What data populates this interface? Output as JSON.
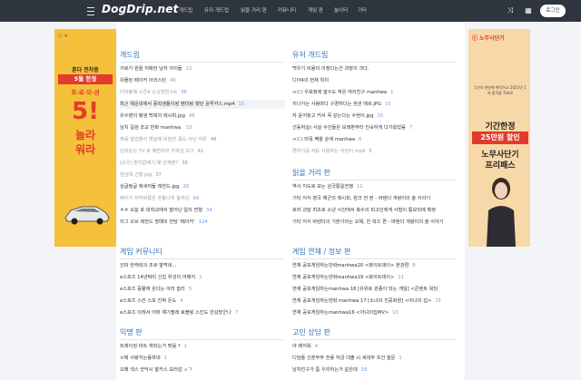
{
  "header": {
    "logo": "DogDrip.net",
    "nav": [
      "개드립",
      "유저 개드립",
      "읽을 거리 판",
      "커뮤니티",
      "게임 판",
      "놀이터",
      "기타"
    ],
    "login_label": "로그인"
  },
  "ads": {
    "left": {
      "badge": "ⓘ ×",
      "line1": "혼다 전차종",
      "line2": "5월 한정",
      "line3": "프·로·모·션",
      "line4": "5!",
      "line5": "놀라",
      "line6": "워라"
    },
    "right": {
      "badge": "ⓒ 노무사단기",
      "small": "1년차 한번에 취득하고 2025년 1차 합격을 목표로",
      "line1": "기간한정",
      "line2": "25만원 할인",
      "line3": "노무사단기",
      "line4": "프리패스"
    }
  },
  "sections": {
    "gaedrip": {
      "title": "개드립",
      "items": [
        {
          "t": "가로가 원을 지배한 남자 아이들",
          "c": "22"
        },
        {
          "t": "유물된 페이커 아리스틴",
          "c": "40"
        },
        {
          "t": "디마불패 시즌4 소상방연.txt",
          "c": "36"
        },
        {
          "t": "최근 해운대에서 중학생들이랑 팬미팅 했던 윤루카스.mp4",
          "c": "15"
        },
        {
          "t": "유수영의 평생 백복이 레시피.jpg",
          "c": "48"
        },
        {
          "t": "남치 길검 조교 만화 manhwa.",
          "c": "33"
        },
        {
          "t": "파를 벌었을어 맨날에 비밀한 콩도 아닌 여유",
          "c": "48"
        },
        {
          "t": "인라운은 TV 로 해변처리 카르님 보기",
          "c": "41"
        },
        {
          "t": "[오우] 펀치없애기 왜 단체엔?",
          "c": "38"
        },
        {
          "t": "현남대 근황.jpg",
          "c": "37"
        },
        {
          "t": "싱글벙글 애새끼들 레전드.jpg",
          "c": "28"
        },
        {
          "t": "배우가 저작바롱은 흔들나게 들려감",
          "c": "94"
        },
        {
          "t": "ㅎㅎ 오늘 포 대학교에서 발어난 일의 전형",
          "c": "34"
        },
        {
          "t": "리그 오브 레전드 명예의 전당 '페이커'",
          "c": "124"
        }
      ]
    },
    "user": {
      "title": "유저 개드립",
      "items": [
        {
          "t": "백우기 비용이 이정다는건 과장이 크다.",
          "c": ""
        },
        {
          "t": "디아4의 현재 위치",
          "c": ""
        },
        {
          "t": "ㅆㄷ) 우표정에 말수도 적은 여자친구 manhwa",
          "c": "1"
        },
        {
          "t": "지나가는 사람마다 구경하다는 현관 에르.JPG",
          "c": "15"
        },
        {
          "t": "자 윤어놓고 커서 꼭 갚는다는 수현이.jpg",
          "c": "15"
        },
        {
          "t": "선동하실) 사실 수인들은 모래판부터 진숙하게 다가왔었음",
          "c": "7"
        },
        {
          "t": "ㅆㄷ) 마목 팩을 순애 manhwa",
          "c": "6"
        },
        {
          "t": "편하기를 자듣 사람하는 어떤이.mp4",
          "c": "5"
        }
      ]
    },
    "read": {
      "title": "읽을 거리 판",
      "items": [
        {
          "t": "역사    지도로 보는 삼국통일전쟁",
          "c": "11"
        },
        {
          "t": "기타 지식    영국 해군의 레시피, 원크 전 펀 - 바텐더 개량이의 술 이야기",
          "c": ""
        },
        {
          "t": "호러 괴담    최초로 소년 사건에서 북수의 피고인에게 사형이 통보되에 확정",
          "c": ""
        },
        {
          "t": "기타 지식    바텐더의 기본가라는 오해, 진 피즈 편 - 바텐더 개량이의 술 이야기",
          "c": ""
        }
      ]
    },
    "gamecom": {
      "title": "게임 커뮤니티",
      "items": [
        {
          "t": "인파    한캐릭의 조큐 잘먹네...",
          "c": ""
        },
        {
          "t": "e스포츠    14년짜리 신입 위성이 어때지",
          "c": "1"
        },
        {
          "t": "e스포츠    중물에 온다는 아리 쉽리",
          "c": "5"
        },
        {
          "t": "e스포츠    스킨 스포 진짜 돈도",
          "c": "4"
        },
        {
          "t": "e스포츠    이레서 어떠 예기필레 로블랑 스킨도 안김방군나",
          "c": "7"
        }
      ]
    },
    "gamenews": {
      "title": "게임 연재 / 정보 판",
      "items": [
        {
          "t": "연재    공포게임하는만화manhwa20 <화이트데이> 본관편",
          "c": "8"
        },
        {
          "t": "연재    공포게임하는만화manhwa19 <화이트데이>",
          "c": "11"
        },
        {
          "t": "연재    공포게임하는manhwa 18 [유위로 관종이 되는 게임] <콘텐트 워딩",
          "c": ""
        },
        {
          "t": "연재    공포게임하는만화 manhwa 17 [소녀의 진흙화원] <아녀의 집>",
          "c": "15"
        },
        {
          "t": "연재    공포게임하는manhwa16 <아녀의집MV>",
          "c": "10"
        }
      ]
    },
    "anon": {
      "title": "익명 판",
      "items": [
        {
          "t": "트레이징 비트 재되는거 맞음 ?",
          "c": "1"
        },
        {
          "t": "ㅂ메 사랑지는용퍼네",
          "c": "1"
        },
        {
          "t": "오메 섹스 숫닥시 발카스 보러감 ㅅㄱ",
          "c": ""
        }
      ]
    },
    "consult": {
      "title": "고민 상담 판",
      "items": [
        {
          "t": "야 왜지워",
          "c": "4"
        },
        {
          "t": "디딤돌 신혼부부 전용 자금 대출 시 세대주 조건 질문",
          "c": "1"
        },
        {
          "t": "남자친구가 좀 우리하는거 같은데",
          "c": "18"
        }
      ]
    }
  }
}
